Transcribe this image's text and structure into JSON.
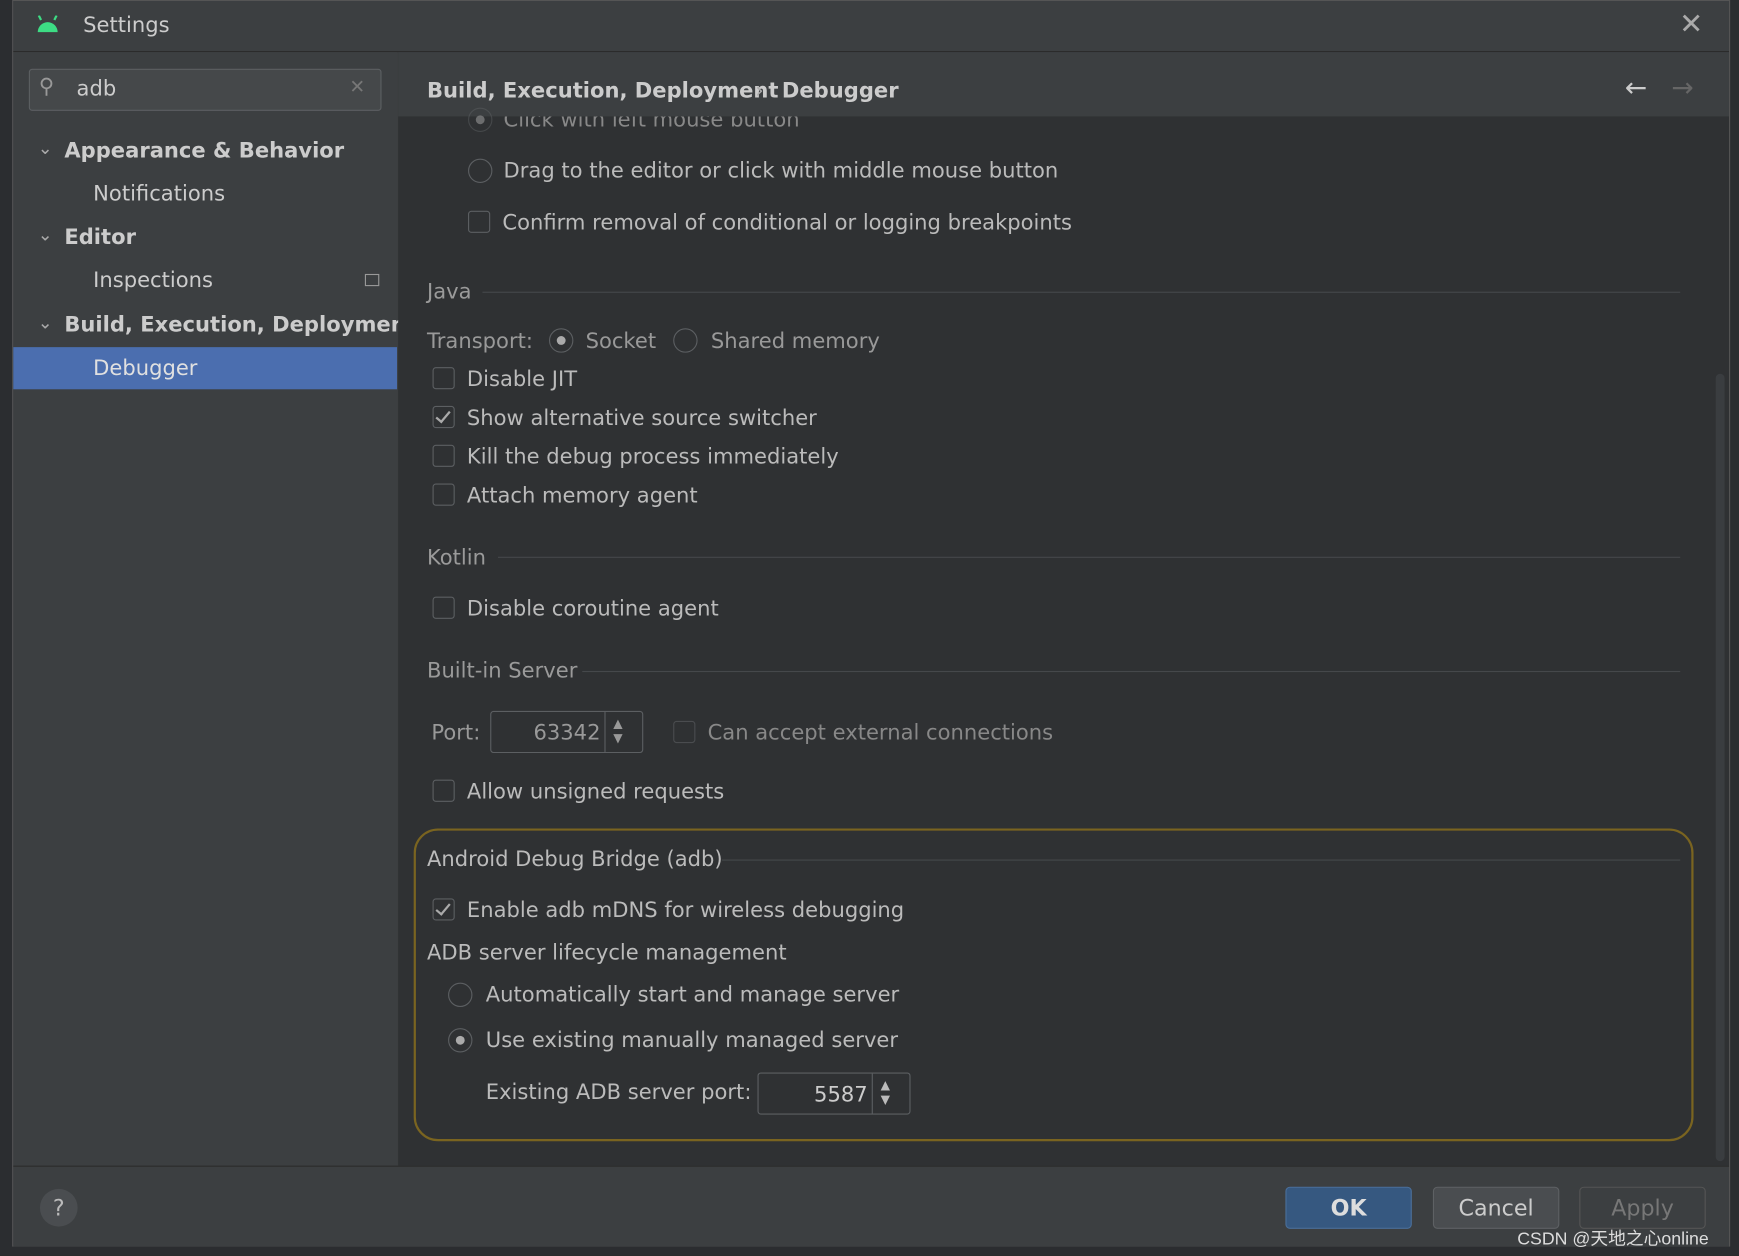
{
  "window": {
    "title": "Settings",
    "icon": "android-icon"
  },
  "search": {
    "value": "adb"
  },
  "sidebar": {
    "items": [
      {
        "label": "Appearance & Behavior",
        "expanded": true
      },
      {
        "label": "Notifications"
      },
      {
        "label": "Editor",
        "expanded": true
      },
      {
        "label": "Inspections"
      },
      {
        "label": "Build, Execution, Deployment",
        "expanded": true
      },
      {
        "label": "Debugger",
        "selected": true
      }
    ]
  },
  "breadcrumb": {
    "parent": "Build, Execution, Deployment",
    "separator": "›",
    "current": "Debugger"
  },
  "breakpoints": {
    "click_left": "Click with left mouse button",
    "drag": "Drag to the editor or click with middle mouse button",
    "confirm_removal": "Confirm removal of conditional or logging breakpoints"
  },
  "java": {
    "title": "Java",
    "transport_label": "Transport:",
    "socket": "Socket",
    "shared_memory": "Shared memory",
    "disable_jit": "Disable JIT",
    "show_alt": "Show alternative source switcher",
    "kill": "Kill the debug process immediately",
    "attach": "Attach memory agent"
  },
  "kotlin": {
    "title": "Kotlin",
    "disable_coroutine": "Disable coroutine agent"
  },
  "server": {
    "title": "Built-in Server",
    "port_label": "Port:",
    "port": "63342",
    "external": "Can accept external connections",
    "unsigned": "Allow unsigned requests"
  },
  "adb": {
    "title": "Android Debug Bridge (adb)",
    "mdns": "Enable adb mDNS for wireless debugging",
    "lifecycle": "ADB server lifecycle management",
    "auto": "Automatically start and manage server",
    "manual": "Use existing manually managed server",
    "port_label": "Existing ADB server port:",
    "port": "5587"
  },
  "footer": {
    "ok": "OK",
    "cancel": "Cancel",
    "apply": "Apply",
    "help": "?"
  },
  "watermark": "CSDN @天地之心online",
  "colors": {
    "accent": "#4b6eaf",
    "highlight": "#8a6d1e",
    "ok": "#365880"
  }
}
